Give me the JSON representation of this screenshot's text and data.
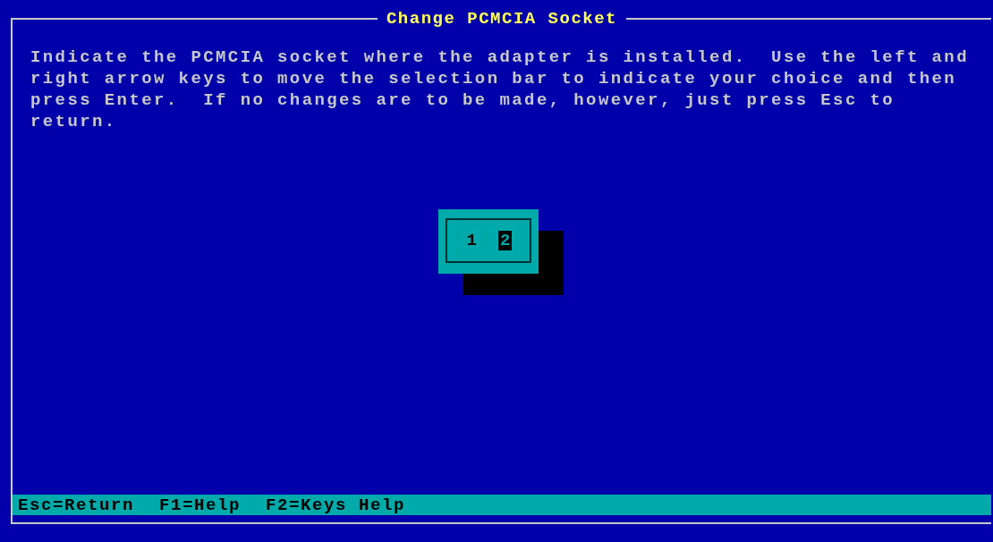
{
  "window": {
    "title": "Change PCMCIA Socket"
  },
  "instructions": [
    "Indicate the PCMCIA socket where the adapter is installed.  Use the left and",
    "right arrow keys to move the selection bar to indicate your choice and then",
    "press Enter.  If no changes are to be made, however, just press Esc to",
    "return."
  ],
  "sockets": [
    {
      "label": "1",
      "selected": false
    },
    {
      "label": "2",
      "selected": true
    }
  ],
  "status_bar": [
    "Esc=Return",
    "F1=Help",
    "F2=Keys Help"
  ]
}
